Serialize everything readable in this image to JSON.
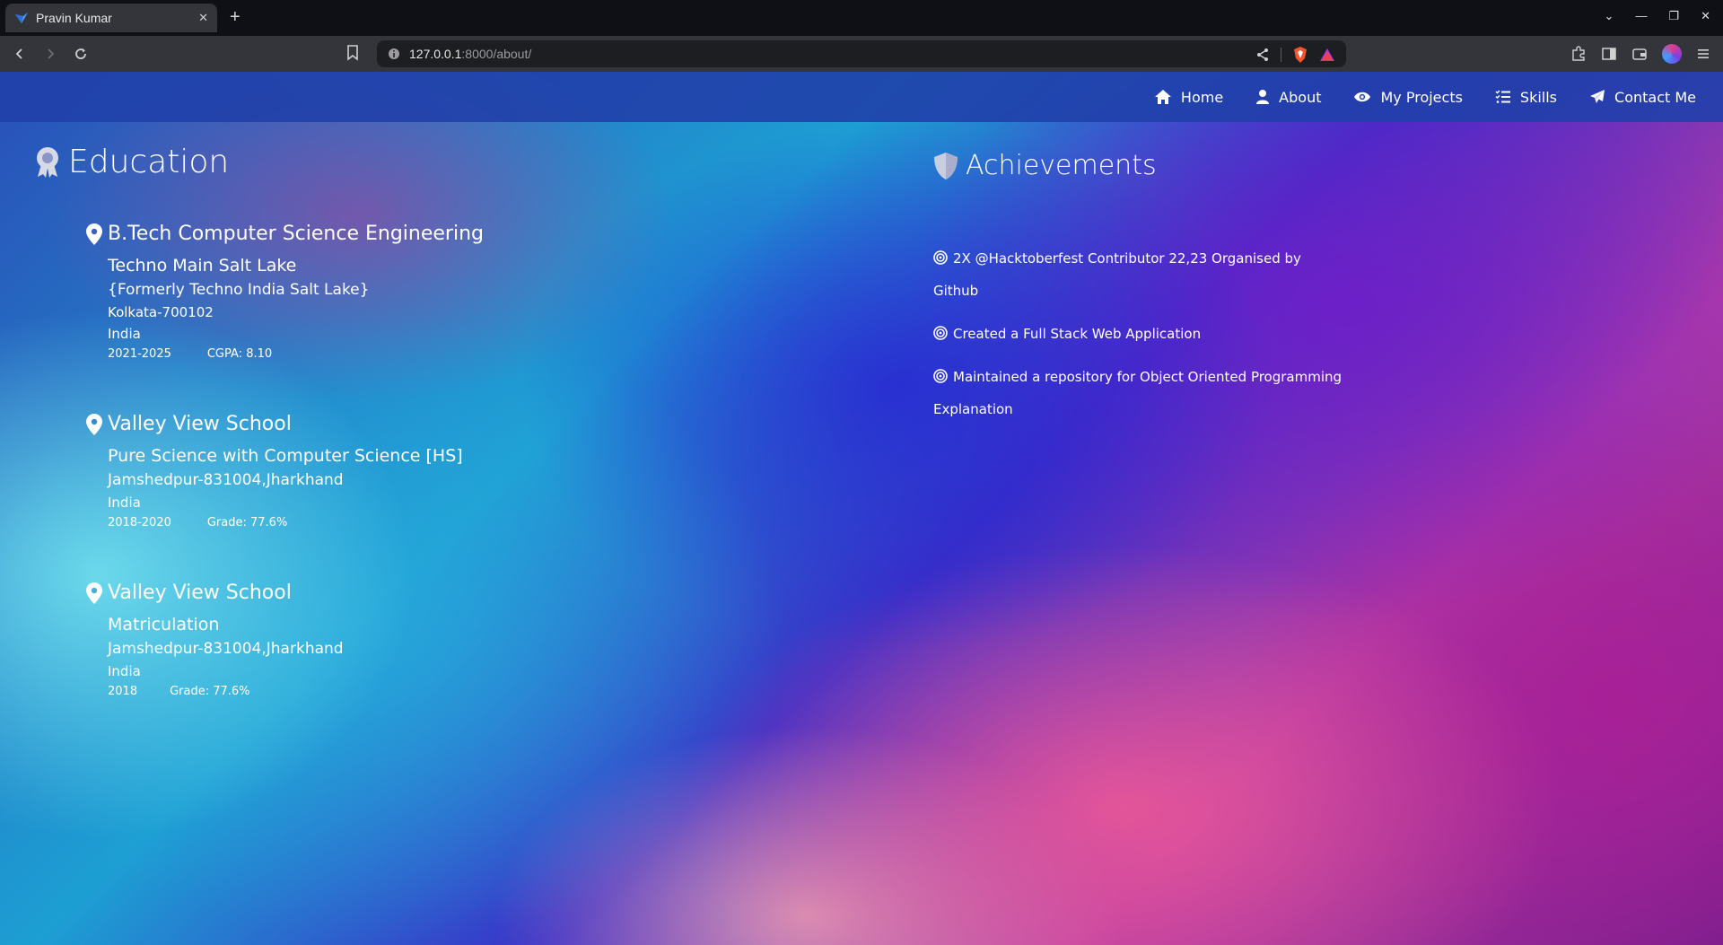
{
  "browser": {
    "tab_title": "Pravin Kumar",
    "url_host": "127.0.0.1",
    "url_path": ":8000/about/"
  },
  "nav": {
    "items": [
      {
        "label": "Home",
        "icon": "home-icon"
      },
      {
        "label": "About",
        "icon": "user-icon"
      },
      {
        "label": "My Projects",
        "icon": "eye-icon"
      },
      {
        "label": "Skills",
        "icon": "list-check-icon"
      },
      {
        "label": "Contact Me",
        "icon": "paper-plane-icon"
      }
    ]
  },
  "education": {
    "title": "Education",
    "entries": [
      {
        "degree": "B.Tech Computer Science Engineering",
        "institution": "Techno Main Salt Lake",
        "formerly": "{Formerly Techno India Salt Lake}",
        "city": "Kolkata-700102",
        "country": "India",
        "years": "2021-2025",
        "score": "CGPA: 8.10"
      },
      {
        "degree": "Valley View School",
        "institution": "Pure Science with Computer Science [HS]",
        "city": "Jamshedpur-831004,Jharkhand",
        "country": "India",
        "years": "2018-2020",
        "score": "Grade: 77.6%"
      },
      {
        "degree": "Valley View School",
        "institution": "Matriculation",
        "city": "Jamshedpur-831004,Jharkhand",
        "country": "India",
        "years": "2018",
        "score": "Grade: 77.6%"
      }
    ]
  },
  "achievements": {
    "title": "Achievements",
    "items": [
      "2X @Hacktoberfest Contributor 22,23 Organised by Github",
      "Created a Full Stack Web Application",
      "Maintained a repository for Object Oriented Programming Explanation"
    ]
  }
}
